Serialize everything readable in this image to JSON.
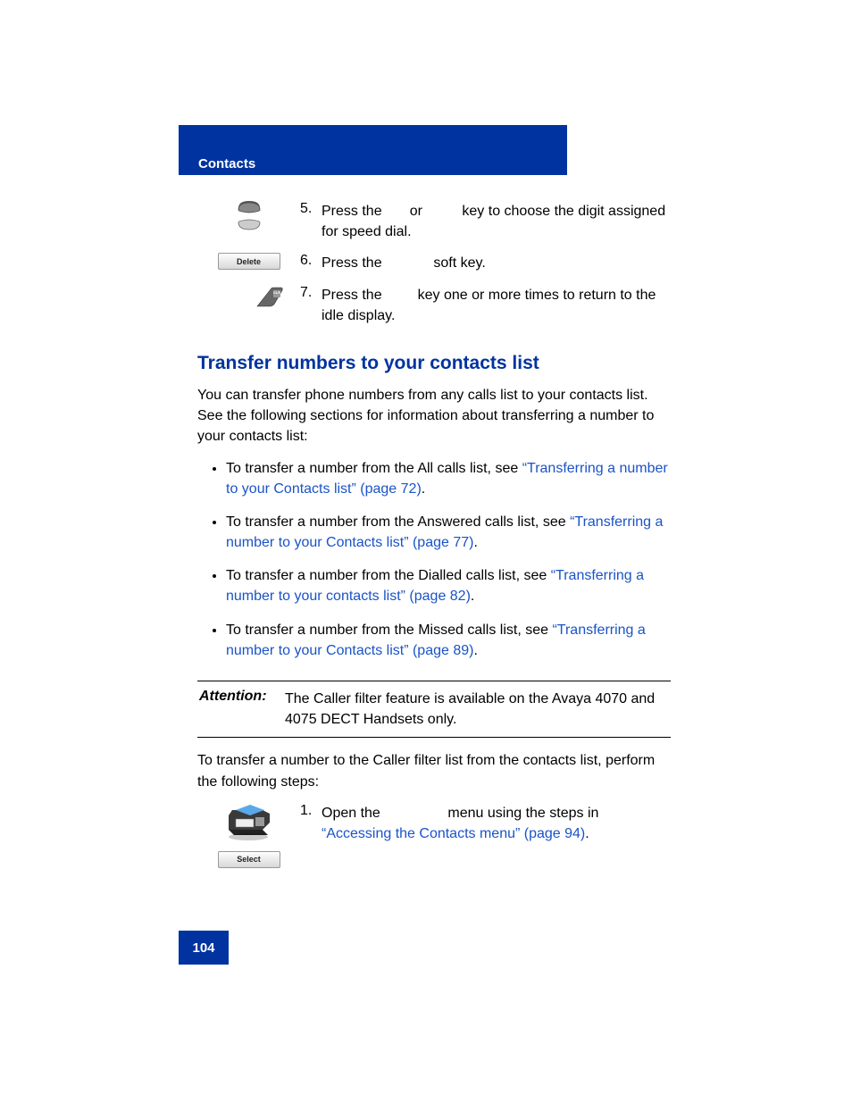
{
  "header": {
    "section": "Contacts"
  },
  "steps_top": [
    {
      "num": "5.",
      "text_before": "Press the ",
      "mid": " or ",
      "text_after": " key to choose the digit assigned for speed dial.",
      "icon": "nav-updown"
    },
    {
      "num": "6.",
      "text_before": "Press the ",
      "text_after": " soft key.",
      "icon": "delete-key",
      "icon_label": "Delete"
    },
    {
      "num": "7.",
      "text_before": "Press the ",
      "text_after": " key one or more times to return to the idle display.",
      "icon": "clr-key"
    }
  ],
  "heading": "Transfer numbers to your contacts list",
  "intro": "You can transfer phone numbers from any calls list to your contacts list. See the following sections for information about transferring a number to your contacts list:",
  "bullets": [
    {
      "pre": "To transfer a number from the All calls list, see ",
      "link": "“Transferring a number to your Contacts list” (page 72)",
      "post": "."
    },
    {
      "pre": "To transfer a number from the Answered calls list, see ",
      "link": "“Transferring a number to your Contacts list” (page 77)",
      "post": "."
    },
    {
      "pre": "To transfer a number from the Dialled calls list, see ",
      "link": "“Transferring a number to your contacts list” (page 82)",
      "post": "."
    },
    {
      "pre": "To transfer a number from the Missed calls list, see ",
      "link": "“Transferring a number to your Contacts list” (page 89)",
      "post": "."
    }
  ],
  "attention": {
    "label": "Attention:",
    "text": "The Caller filter feature is available on the Avaya 4070 and 4075 DECT Handsets only."
  },
  "post_attention": "To transfer a number to the Caller filter list from the contacts list, perform the following steps:",
  "steps_bottom": [
    {
      "num": "1.",
      "text_before": "Open the ",
      "text_after": " menu using the steps in ",
      "link": "“Accessing the Contacts menu” (page 94)",
      "post": ".",
      "icon": "fax-select",
      "icon_label": "Select"
    }
  ],
  "page_number": "104"
}
